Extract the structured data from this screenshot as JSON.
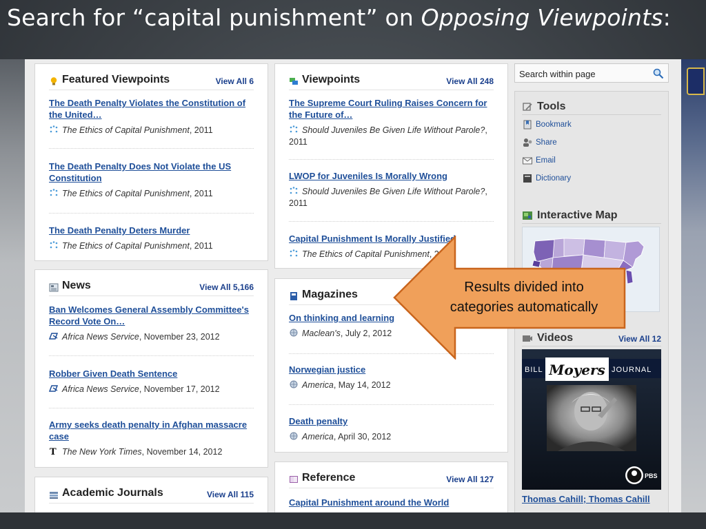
{
  "slide": {
    "title_prefix": "Search for “capital punishment” on ",
    "title_italic": "Opposing Viewpoints",
    "title_suffix": ":"
  },
  "featured": {
    "title": "Featured Viewpoints",
    "view_all": "View All 6",
    "items": [
      {
        "link": "The Death Penalty Violates the Constitution of the United…",
        "source": "The Ethics of Capital Punishment",
        "year": ", 2011"
      },
      {
        "link": "The Death Penalty Does Not Violate the US Constitution",
        "source": "The Ethics of Capital Punishment",
        "year": ", 2011"
      },
      {
        "link": "The Death Penalty Deters Murder",
        "source": "The Ethics of Capital Punishment",
        "year": ", 2011"
      }
    ]
  },
  "viewpoints": {
    "title": "Viewpoints",
    "view_all": "View All 248",
    "items": [
      {
        "link": "The Supreme Court Ruling Raises Concern for the Future of…",
        "source": "Should Juveniles Be Given Life Without Parole?",
        "year": ", 2011"
      },
      {
        "link": "LWOP for Juveniles Is Morally Wrong",
        "source": "Should Juveniles Be Given Life Without Parole?",
        "year": ", 2011"
      },
      {
        "link": "Capital Punishment Is Morally Justified",
        "source": "The Ethics of Capital Punishment",
        "year": ", 2011"
      }
    ]
  },
  "news": {
    "title": "News",
    "view_all": "View All 5,166",
    "items": [
      {
        "link": "Ban Welcomes General Assembly Committee's Record Vote On…",
        "source": "Africa News Service",
        "date": ", November 23, 2012"
      },
      {
        "link": "Robber Given Death Sentence",
        "source": "Africa News Service",
        "date": ", November 17, 2012"
      },
      {
        "link": "Army seeks death penalty in Afghan massacre case",
        "source": "The New York Times",
        "date": ", November 14, 2012"
      }
    ]
  },
  "magazines": {
    "title": "Magazines",
    "items": [
      {
        "link": "On thinking and learning",
        "source": "Maclean's",
        "date": ", July 2, 2012"
      },
      {
        "link": "Norwegian justice",
        "source": "America",
        "date": ", May 14, 2012"
      },
      {
        "link": "Death penalty",
        "source": "America",
        "date": ", April 30, 2012"
      }
    ]
  },
  "academic": {
    "title": "Academic Journals",
    "view_all": "View All 115"
  },
  "reference": {
    "title": "Reference",
    "view_all": "View All 127",
    "items": [
      {
        "link": "Capital Punishment around the World"
      }
    ]
  },
  "search": {
    "value": "Search within page"
  },
  "tools": {
    "title": "Tools",
    "items": [
      {
        "label": "Bookmark"
      },
      {
        "label": "Share"
      },
      {
        "label": "Email"
      },
      {
        "label": "Dictionary"
      }
    ]
  },
  "map": {
    "title": "Interactive Map"
  },
  "videos": {
    "title": "Videos",
    "view_all": "View All 12",
    "banner_left": "BILL",
    "banner_mid": "Moyers",
    "banner_right": "JOURNAL",
    "network": "PBS",
    "caption": "Thomas Cahill; Thomas Cahill"
  },
  "callout": {
    "line1": "Results divided into",
    "line2": "categories automatically"
  },
  "colors": {
    "link": "#1f4f99",
    "viewall": "#1a3f8c",
    "callout_fill": "#f0a05a",
    "callout_stroke": "#c9651d"
  }
}
